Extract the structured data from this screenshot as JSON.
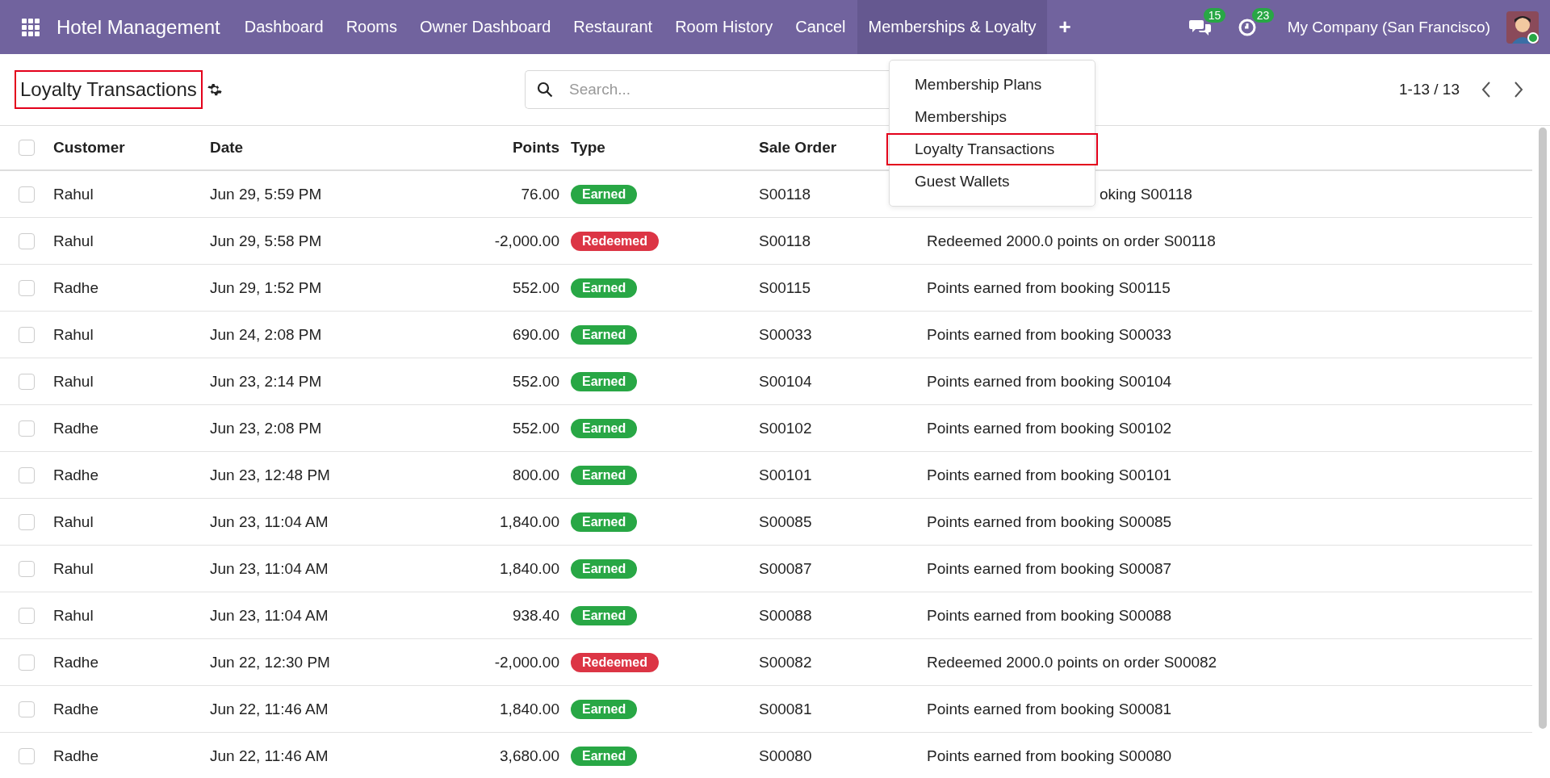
{
  "navbar": {
    "app_title": "Hotel Management",
    "menus": [
      {
        "label": "Dashboard",
        "selected": false
      },
      {
        "label": "Rooms",
        "selected": false
      },
      {
        "label": "Owner Dashboard",
        "selected": false
      },
      {
        "label": "Restaurant",
        "selected": false
      },
      {
        "label": "Room History",
        "selected": false
      },
      {
        "label": "Cancel",
        "selected": false
      },
      {
        "label": "Memberships & Loyalty",
        "selected": true
      }
    ],
    "plus": "+",
    "messages_count": "15",
    "activities_count": "23",
    "company": "My Company (San Francisco)"
  },
  "dropdown": {
    "items": [
      {
        "label": "Membership Plans",
        "highlighted": false
      },
      {
        "label": "Memberships",
        "highlighted": false
      },
      {
        "label": "Loyalty Transactions",
        "highlighted": true
      },
      {
        "label": "Guest Wallets",
        "highlighted": false
      }
    ]
  },
  "control_panel": {
    "title": "Loyalty Transactions",
    "title_highlighted": true,
    "search": {
      "placeholder": "Search..."
    },
    "pager": "1-13 / 13"
  },
  "table": {
    "all_checked": false,
    "columns": [
      "Customer",
      "Date",
      "Points",
      "Type",
      "Sale Order"
    ],
    "rows": [
      {
        "checked": false,
        "customer": "Rahul",
        "date": "Jun 29, 5:59 PM",
        "points": "76.00",
        "type": "Earned",
        "kind": "earned",
        "sale_order": "S00118",
        "description": "oking S00118",
        "covered": true
      },
      {
        "checked": false,
        "customer": "Rahul",
        "date": "Jun 29, 5:58 PM",
        "points": "-2,000.00",
        "type": "Redeemed",
        "kind": "redeemed",
        "sale_order": "S00118",
        "description": "Redeemed 2000.0 points on order S00118",
        "covered": false
      },
      {
        "checked": false,
        "customer": "Radhe",
        "date": "Jun 29, 1:52 PM",
        "points": "552.00",
        "type": "Earned",
        "kind": "earned",
        "sale_order": "S00115",
        "description": "Points earned from booking S00115",
        "covered": false
      },
      {
        "checked": false,
        "customer": "Rahul",
        "date": "Jun 24, 2:08 PM",
        "points": "690.00",
        "type": "Earned",
        "kind": "earned",
        "sale_order": "S00033",
        "description": "Points earned from booking S00033",
        "covered": false
      },
      {
        "checked": false,
        "customer": "Rahul",
        "date": "Jun 23, 2:14 PM",
        "points": "552.00",
        "type": "Earned",
        "kind": "earned",
        "sale_order": "S00104",
        "description": "Points earned from booking S00104",
        "covered": false
      },
      {
        "checked": false,
        "customer": "Radhe",
        "date": "Jun 23, 2:08 PM",
        "points": "552.00",
        "type": "Earned",
        "kind": "earned",
        "sale_order": "S00102",
        "description": "Points earned from booking S00102",
        "covered": false
      },
      {
        "checked": false,
        "customer": "Radhe",
        "date": "Jun 23, 12:48 PM",
        "points": "800.00",
        "type": "Earned",
        "kind": "earned",
        "sale_order": "S00101",
        "description": "Points earned from booking S00101",
        "covered": false
      },
      {
        "checked": false,
        "customer": "Rahul",
        "date": "Jun 23, 11:04 AM",
        "points": "1,840.00",
        "type": "Earned",
        "kind": "earned",
        "sale_order": "S00085",
        "description": "Points earned from booking S00085",
        "covered": false
      },
      {
        "checked": false,
        "customer": "Rahul",
        "date": "Jun 23, 11:04 AM",
        "points": "1,840.00",
        "type": "Earned",
        "kind": "earned",
        "sale_order": "S00087",
        "description": "Points earned from booking S00087",
        "covered": false
      },
      {
        "checked": false,
        "customer": "Rahul",
        "date": "Jun 23, 11:04 AM",
        "points": "938.40",
        "type": "Earned",
        "kind": "earned",
        "sale_order": "S00088",
        "description": "Points earned from booking S00088",
        "covered": false
      },
      {
        "checked": false,
        "customer": "Radhe",
        "date": "Jun 22, 12:30 PM",
        "points": "-2,000.00",
        "type": "Redeemed",
        "kind": "redeemed",
        "sale_order": "S00082",
        "description": "Redeemed 2000.0 points on order S00082",
        "covered": false
      },
      {
        "checked": false,
        "customer": "Radhe",
        "date": "Jun 22, 11:46 AM",
        "points": "1,840.00",
        "type": "Earned",
        "kind": "earned",
        "sale_order": "S00081",
        "description": "Points earned from booking S00081",
        "covered": false
      },
      {
        "checked": false,
        "customer": "Radhe",
        "date": "Jun 22, 11:46 AM",
        "points": "3,680.00",
        "type": "Earned",
        "kind": "earned",
        "sale_order": "S00080",
        "description": "Points earned from booking S00080",
        "covered": false
      }
    ]
  }
}
